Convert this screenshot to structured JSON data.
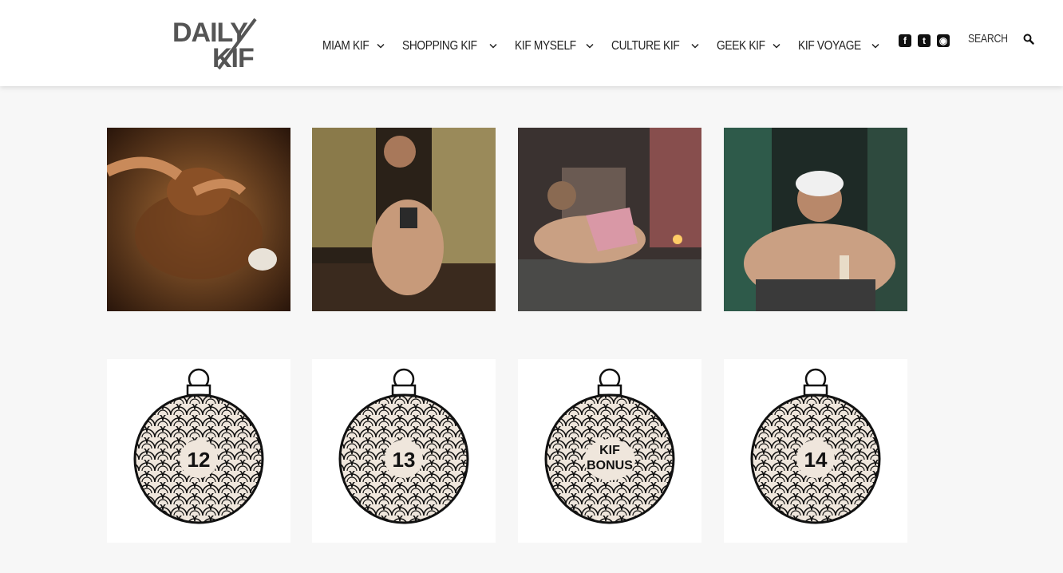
{
  "header": {
    "logo_line1": "DAILY",
    "logo_line2": "KIF",
    "nav": [
      {
        "label": "MIAM KIF"
      },
      {
        "label": "SHOPPING KIF"
      },
      {
        "label": "KIF MYSELF"
      },
      {
        "label": "CULTURE KIF"
      },
      {
        "label": "GEEK KIF"
      },
      {
        "label": "KIF VOYAGE"
      }
    ],
    "social": [
      {
        "icon": "facebook-icon",
        "glyph": "f"
      },
      {
        "icon": "twitter-icon",
        "glyph": "t"
      },
      {
        "icon": "instagram-icon",
        "glyph": "◉"
      }
    ],
    "search_label": "SEARCH"
  },
  "gallery": {
    "photos": [
      {
        "subject": "massage-photo"
      },
      {
        "subject": "bedroom-photo"
      },
      {
        "subject": "fireplace-photo"
      },
      {
        "subject": "bath-photo"
      }
    ],
    "ornaments": [
      {
        "line1": "12",
        "line2": ""
      },
      {
        "line1": "13",
        "line2": ""
      },
      {
        "line1": "KIF",
        "line2": "BONUS"
      },
      {
        "line1": "14",
        "line2": ""
      }
    ]
  },
  "colors": {
    "accent": "#111111",
    "background": "#f7f7f7",
    "ornament_cream": "#efe6dc"
  }
}
